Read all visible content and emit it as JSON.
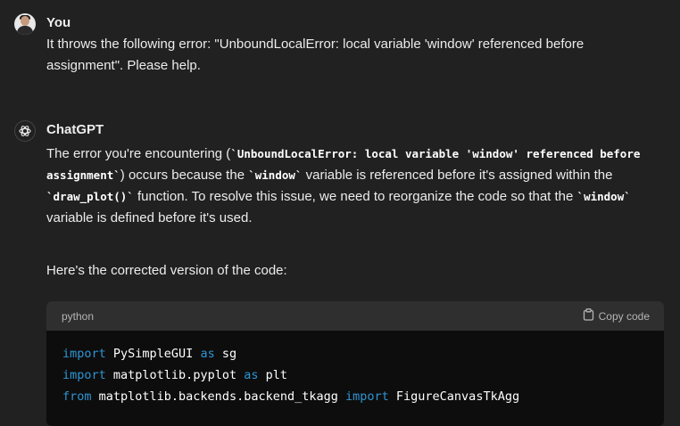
{
  "user": {
    "name": "You",
    "message": "It throws the following error: \"UnboundLocalError: local variable 'window' referenced before assignment\". Please help."
  },
  "assistant": {
    "name": "ChatGPT",
    "p1": {
      "t1": "The error you're encountering (",
      "c1": "`UnboundLocalError: local variable 'window' referenced before assignment`",
      "t2": ") occurs because the ",
      "c2": "`window`",
      "t3": " variable is referenced before it's assigned within the ",
      "c3": "`draw_plot()`",
      "t4": " function. To resolve this issue, we need to reorganize the code so that the ",
      "c4": "`window`",
      "t5": " variable is defined before it's used."
    },
    "p2": "Here's the corrected version of the code:"
  },
  "code_block": {
    "language": "python",
    "copy_label": "Copy code",
    "lines": [
      {
        "kw1": "import",
        "t1": " PySimpleGUI ",
        "kw2": "as",
        "t2": " sg"
      },
      {
        "kw1": "import",
        "t1": " matplotlib.pyplot ",
        "kw2": "as",
        "t2": " plt"
      },
      {
        "kw1": "from",
        "t1": " matplotlib.backends.backend_tkagg ",
        "kw2": "import",
        "t2": " FigureCanvasTkAgg"
      }
    ]
  },
  "icons": {
    "user_avatar": "user-photo",
    "assistant_avatar": "openai-logo-icon",
    "copy": "clipboard-icon"
  },
  "colors": {
    "background": "#212121",
    "code_background": "#0d0d0d",
    "code_header": "#2f2f2f",
    "keyword": "#2e95d3"
  }
}
